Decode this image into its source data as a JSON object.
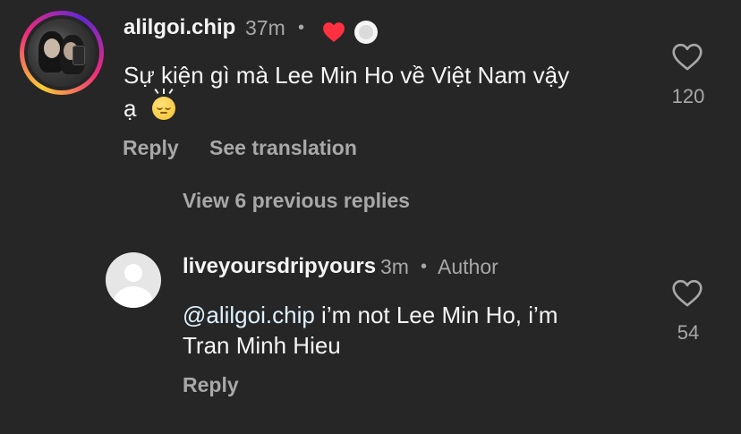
{
  "comment": {
    "username": "alilgoi.chip",
    "time": "37m",
    "text": "Sự kiện gì mà Lee Min Ho về Việt Nam vậy",
    "text_line2": "ạ",
    "like_count": "120",
    "reply_label": "Reply",
    "translate_label": "See translation",
    "author_liked_color": "#ff3040"
  },
  "view_replies": "View 6 previous replies",
  "reply": {
    "username": "liveyoursdripyours",
    "time": "3m",
    "author_tag": "Author",
    "mention": "@alilgoi.chip",
    "text": "i’m not Lee Min Ho, i’m",
    "text_line2": "Tran Minh Hieu",
    "like_count": "54",
    "reply_label": "Reply"
  },
  "separator": "•",
  "icons": {
    "liked_heart": "heart-filled-icon",
    "like": "heart-outline-icon",
    "creator_avatar": "creator-avatar-icon",
    "emoji": "pensive-face-emoji"
  }
}
